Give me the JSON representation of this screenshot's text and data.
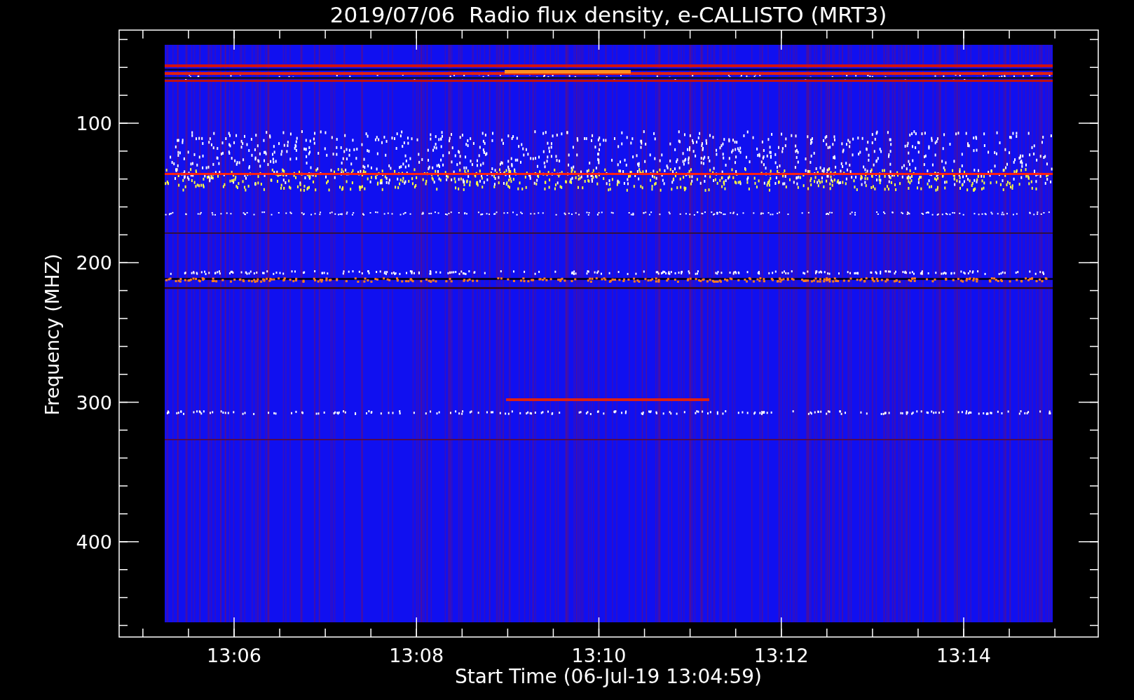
{
  "title": "2019/07/06  Radio flux density, e-CALLISTO (MRT3)",
  "y_axis": {
    "label": "Frequency (MHZ)",
    "ticks": [
      "100",
      "200",
      "300",
      "400"
    ]
  },
  "x_axis": {
    "label": "Start Time (06-Jul-19 13:04:59)",
    "ticks": [
      "13:06",
      "13:08",
      "13:10",
      "13:12",
      "13:14"
    ]
  }
}
